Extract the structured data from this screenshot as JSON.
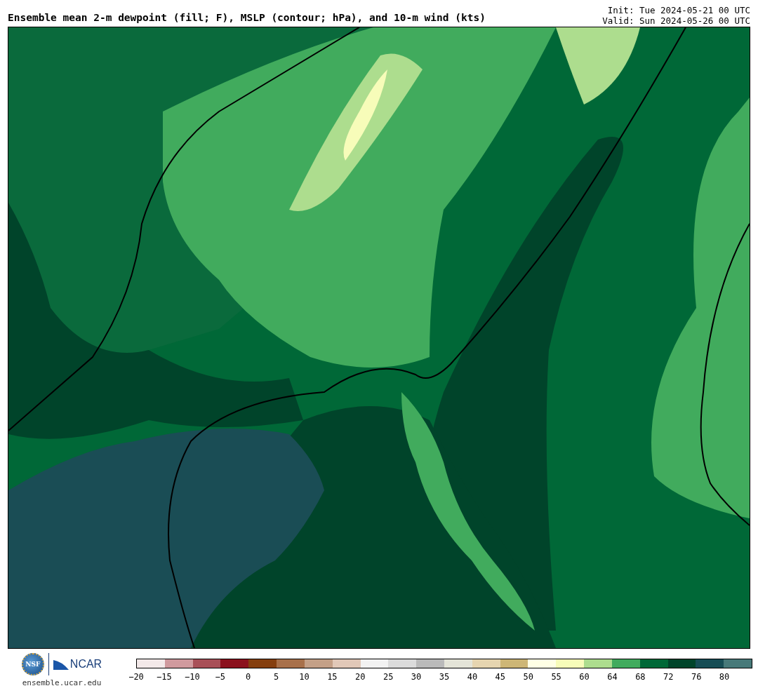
{
  "title": "Ensemble mean 2-m dewpoint (fill; F), MSLP (contour; hPa), and 10-m wind (kts)",
  "init": "Init: Tue 2024-05-21 00 UTC",
  "valid": "Valid: Sun 2024-05-26 00 UTC",
  "logo": {
    "left": "NSF",
    "right": "NCAR",
    "url": "ensemble.ucar.edu"
  },
  "colorbar": {
    "segments": [
      {
        "color": "#f3e9e9"
      },
      {
        "color": "#d09a9e"
      },
      {
        "color": "#a84f57"
      },
      {
        "color": "#8b111d"
      },
      {
        "color": "#853f0f"
      },
      {
        "color": "#a8704a"
      },
      {
        "color": "#c4a087"
      },
      {
        "color": "#e1c8b8"
      },
      {
        "color": "#f2f2f2"
      },
      {
        "color": "#dbdbdb"
      },
      {
        "color": "#bababa"
      },
      {
        "color": "#e4e4d8"
      },
      {
        "color": "#e6d5b0"
      },
      {
        "color": "#cdb676"
      },
      {
        "color": "#ffffe5"
      },
      {
        "color": "#f7fcb9"
      },
      {
        "color": "#addd8e"
      },
      {
        "color": "#41ab5d"
      },
      {
        "color": "#006837"
      },
      {
        "color": "#00442a"
      },
      {
        "color": "#164d55"
      },
      {
        "color": "#477979"
      }
    ],
    "ticks": [
      "−20",
      "−15",
      "−10",
      "−5",
      "0",
      "5",
      "10",
      "15",
      "20",
      "25",
      "30",
      "35",
      "40",
      "45",
      "50",
      "55",
      "60",
      "64",
      "68",
      "72",
      "76",
      "80"
    ]
  }
}
